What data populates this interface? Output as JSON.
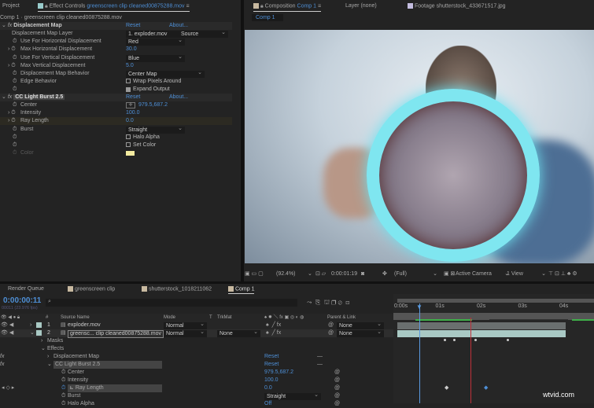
{
  "top_tabs": {
    "project": "Project",
    "effect_controls_label": "Effect Controls",
    "effect_controls_target": "greenscreen clip cleaned00875288.mov",
    "composition_label": "Composition",
    "composition_target": "Comp 1",
    "layer": "Layer (none)",
    "footage": "Footage shutterstock_433671517.jpg",
    "comp_subtab": "Comp 1"
  },
  "effect_controls": {
    "breadcrumb": "Comp 1 · greenscreen clip cleaned00875288.mov",
    "reset": "Reset",
    "about": "About...",
    "displacement": {
      "name": "Displacement Map",
      "props": [
        {
          "label": "Displacement Map Layer",
          "value": "1. exploder.mov",
          "value2": "Source",
          "type": "dropdown"
        },
        {
          "label": "Use For Horizontal Displacement",
          "value": "Red",
          "type": "dropdown"
        },
        {
          "label": "Max Horizontal Displacement",
          "value": "30.0",
          "type": "number"
        },
        {
          "label": "Use For Vertical Displacement",
          "value": "Blue",
          "type": "dropdown"
        },
        {
          "label": "Max Vertical Displacement",
          "value": "5.0",
          "type": "number"
        },
        {
          "label": "Displacement Map Behavior",
          "value": "Center Map",
          "type": "dropdown"
        },
        {
          "label": "Edge Behavior",
          "value": "Wrap Pixels Around",
          "type": "checkbox",
          "checked": false
        },
        {
          "label": "",
          "value": "Expand Output",
          "type": "checkbox",
          "checked": true
        }
      ]
    },
    "lightburst": {
      "name": "CC Light Burst 2.5",
      "props": [
        {
          "label": "Center",
          "value": "979.5,687.2",
          "type": "point"
        },
        {
          "label": "Intensity",
          "value": "100.0",
          "type": "number"
        },
        {
          "label": "Ray Length",
          "value": "0.0",
          "type": "number"
        },
        {
          "label": "Burst",
          "value": "Straight",
          "type": "dropdown"
        },
        {
          "label": "",
          "value": "Halo Alpha",
          "type": "checkbox",
          "checked": false
        },
        {
          "label": "",
          "value": "Set Color",
          "type": "checkbox",
          "checked": false
        },
        {
          "label": "Color",
          "value": "",
          "type": "color",
          "color": "#f3eba0"
        }
      ]
    }
  },
  "viewer_toolbar": {
    "zoom": "(92.4%)",
    "timecode": "0:00:01:19",
    "resolution": "(Full)",
    "camera": "Active Camera",
    "views": "1 View"
  },
  "timeline": {
    "tabs": [
      "Render Queue",
      "greenscreen clip",
      "shutterstock_1018211062",
      "Comp 1"
    ],
    "timecode": "0:00:00:11",
    "fps": "00011 (23.976 fps)",
    "columns": {
      "source": "Source Name",
      "mode": "Mode",
      "t": "T",
      "trkmat": "TrkMat",
      "parent": "Parent & Link",
      "num": "#"
    },
    "layers": [
      {
        "num": "1",
        "name": "exploder.mov",
        "mode": "Normal",
        "trkmat": "",
        "parent": "None"
      },
      {
        "num": "2",
        "name": "greensc... clip cleaned00875288.mov",
        "mode": "Normal",
        "trkmat": "None",
        "parent": "None"
      }
    ],
    "tree": [
      {
        "label": "Masks",
        "indent": 1
      },
      {
        "label": "Effects",
        "indent": 1
      },
      {
        "label": "Displacement Map",
        "indent": 2,
        "value": "Reset"
      },
      {
        "label": "CC Light Burst 2.5",
        "indent": 2,
        "value": "Reset"
      },
      {
        "label": "Center",
        "indent": 3,
        "value": "979.5,687.2"
      },
      {
        "label": "Intensity",
        "indent": 3,
        "value": "100.0"
      },
      {
        "label": "Ray Length",
        "indent": 3,
        "value": "0.0"
      },
      {
        "label": "Burst",
        "indent": 3,
        "value": "Straight"
      },
      {
        "label": "Halo Alpha",
        "indent": 3,
        "value": "Off"
      }
    ],
    "ruler": [
      "0:00s",
      "01s",
      "02s",
      "03s",
      "04s"
    ]
  },
  "watermark": "wtvid.com",
  "colors": {
    "accent": "#4e8fd6",
    "layer_bar": "#a9c9c4",
    "work_area": "#3fae49",
    "playhead": "#5a9ae0",
    "cti_red": "#c0303a"
  }
}
